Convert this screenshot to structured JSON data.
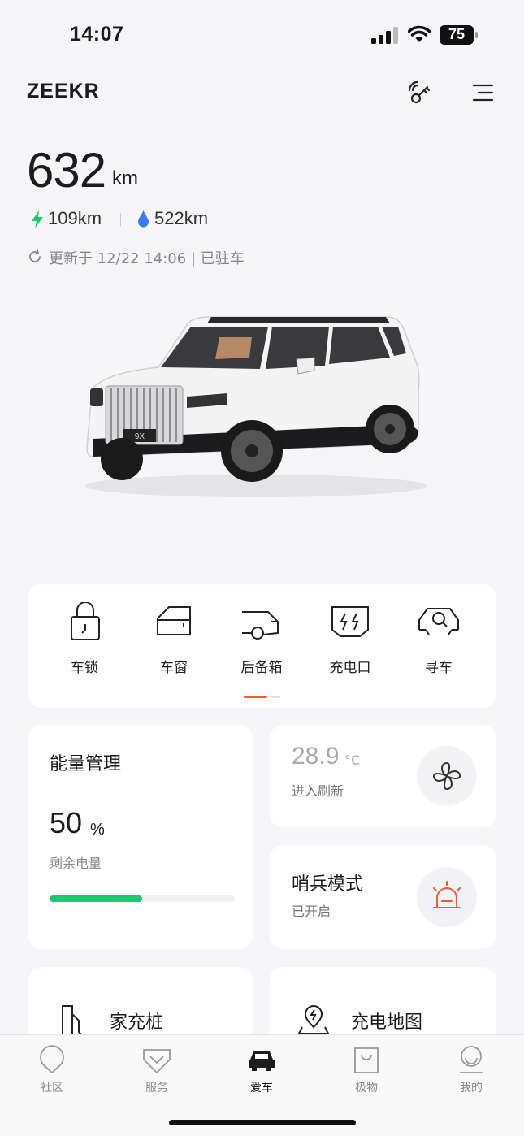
{
  "status_bar": {
    "time": "14:07",
    "battery": "75"
  },
  "header": {
    "brand": "ZEEKR"
  },
  "range": {
    "total": "632",
    "unit": "km",
    "electric": "109km",
    "fuel": "522km",
    "update_text": "更新于 12/22 14:06 | 已驻车"
  },
  "car": {
    "plate": "9X"
  },
  "quick_controls": [
    {
      "label": "车锁",
      "icon": "lock-icon"
    },
    {
      "label": "车窗",
      "icon": "window-icon"
    },
    {
      "label": "后备箱",
      "icon": "trunk-icon"
    },
    {
      "label": "充电口",
      "icon": "charge-port-icon"
    },
    {
      "label": "寻车",
      "icon": "find-car-icon"
    }
  ],
  "energy": {
    "title": "能量管理",
    "percent": "50",
    "unit": "%",
    "subtitle": "剩余电量",
    "level": 0.5
  },
  "climate": {
    "temperature": "28.9",
    "unit": "°C",
    "subtitle": "进入刷新"
  },
  "sentry": {
    "title": "哨兵模式",
    "status": "已开启"
  },
  "home_charger": {
    "title": "家充桩"
  },
  "charge_map": {
    "title": "充电地图"
  },
  "tabs": [
    {
      "label": "社区",
      "icon": "community-icon"
    },
    {
      "label": "服务",
      "icon": "service-icon"
    },
    {
      "label": "爱车",
      "icon": "car-icon",
      "active": true
    },
    {
      "label": "极物",
      "icon": "shop-icon"
    },
    {
      "label": "我的",
      "icon": "profile-icon"
    }
  ],
  "colors": {
    "accent": "#f05a3a",
    "energy_bar": "#21c76d",
    "electric": "#21c76d",
    "fuel": "#3a7cf0"
  }
}
